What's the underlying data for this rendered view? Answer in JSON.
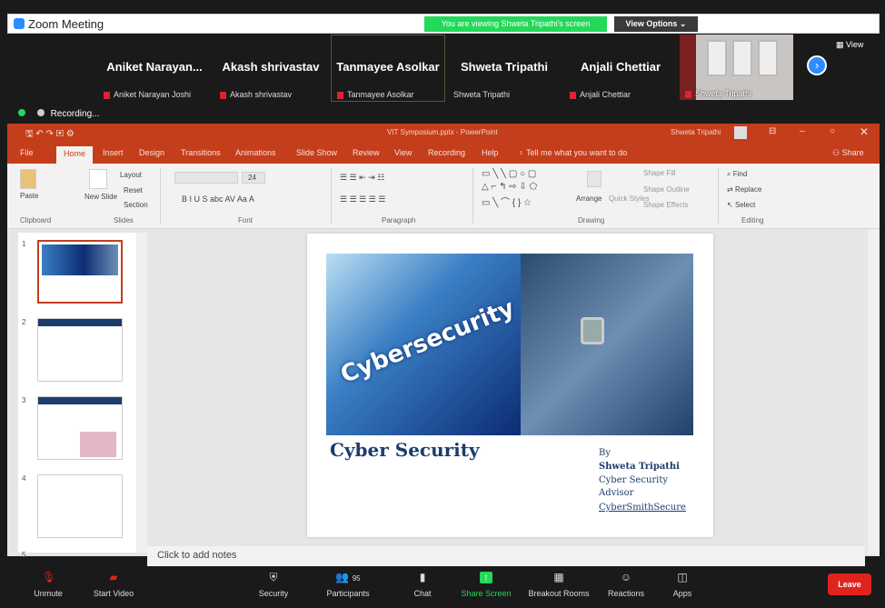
{
  "window": {
    "title": "Zoom Meeting"
  },
  "share_banner": {
    "text": "You are viewing Shweta Tripathi's screen",
    "view_options": "View Options"
  },
  "participants": [
    {
      "display": "Aniket Narayan...",
      "name": "Aniket Narayan Joshi",
      "muted": true
    },
    {
      "display": "Akash shrivastav",
      "name": "Akash shrivastav",
      "muted": true
    },
    {
      "display": "Tanmayee Asolkar",
      "name": "Tanmayee Asolkar",
      "muted": true,
      "active": true
    },
    {
      "display": "Shweta Tripathi",
      "name": "Shweta Tripathi",
      "muted": false
    },
    {
      "display": "Anjali Chettiar",
      "name": "Anjali Chettiar",
      "muted": true
    }
  ],
  "video_tile": {
    "name": "Shweta Tripathi"
  },
  "view_button": "View",
  "recording": "Recording...",
  "powerpoint": {
    "doc_title": "VIT Symposium.pptx - PowerPoint",
    "user": "Shweta Tripathi",
    "tabs": [
      "File",
      "Home",
      "Insert",
      "Design",
      "Transitions",
      "Animations",
      "Slide Show",
      "Review",
      "View",
      "Recording",
      "Help"
    ],
    "selected_tab": "Home",
    "tell_me": "Tell me what you want to do",
    "share": "Share",
    "ribbon": {
      "paste": "Paste",
      "new_slide": "New Slide",
      "layout": "Layout",
      "reset": "Reset",
      "section": "Section",
      "font_size": "24",
      "arrange": "Arrange",
      "quick_styles": "Quick Styles",
      "shape_fill": "Shape Fill",
      "shape_outline": "Shape Outline",
      "shape_effects": "Shape Effects",
      "find": "Find",
      "replace": "Replace",
      "select": "Select",
      "groups": [
        "Clipboard",
        "Slides",
        "Font",
        "Paragraph",
        "Drawing",
        "Editing"
      ]
    },
    "slide_numbers": [
      "1",
      "2",
      "3",
      "4",
      "5"
    ],
    "slide": {
      "banner_word": "Cybersecurity",
      "title": "Cyber Security",
      "by": "By",
      "author": "Shweta Tripathi",
      "role1": "Cyber Security",
      "role2": "Advisor",
      "company": "CyberSmithSecure"
    },
    "notes_placeholder": "Click to add notes"
  },
  "toolbar": [
    {
      "label": "Unmute",
      "icon": "mic-muted-icon"
    },
    {
      "label": "Start Video",
      "icon": "video-off-icon"
    },
    {
      "label": "Security",
      "icon": "shield-icon"
    },
    {
      "label": "Participants",
      "icon": "participants-icon",
      "count": "95"
    },
    {
      "label": "Chat",
      "icon": "chat-icon"
    },
    {
      "label": "Share Screen",
      "icon": "share-screen-icon"
    },
    {
      "label": "Breakout Rooms",
      "icon": "breakout-icon"
    },
    {
      "label": "Reactions",
      "icon": "reactions-icon"
    },
    {
      "label": "Apps",
      "icon": "apps-icon"
    }
  ],
  "leave_label": "Leave",
  "colors": {
    "ppt_red": "#c43e1c",
    "zoom_blue": "#2d8cff",
    "leave_red": "#e0231c",
    "share_green": "#23d959"
  }
}
